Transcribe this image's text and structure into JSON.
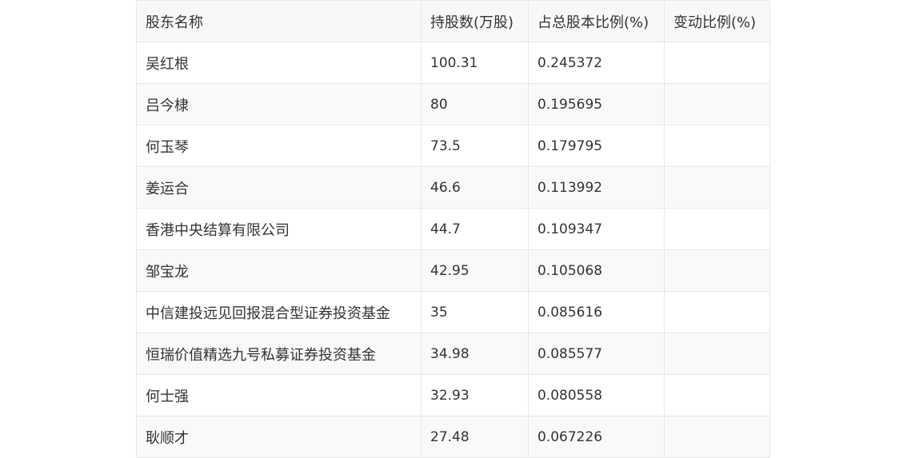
{
  "table": {
    "headers": [
      "股东名称",
      "持股数(万股)",
      "占总股本比例(%)",
      "变动比例(%)"
    ],
    "rows": [
      {
        "name": "吴红根",
        "shares": "100.31",
        "ratio": "0.245372",
        "change": ""
      },
      {
        "name": "吕今棣",
        "shares": "80",
        "ratio": "0.195695",
        "change": ""
      },
      {
        "name": "何玉琴",
        "shares": "73.5",
        "ratio": "0.179795",
        "change": ""
      },
      {
        "name": "姜运合",
        "shares": "46.6",
        "ratio": "0.113992",
        "change": ""
      },
      {
        "name": "香港中央结算有限公司",
        "shares": "44.7",
        "ratio": "0.109347",
        "change": ""
      },
      {
        "name": "邹宝龙",
        "shares": "42.95",
        "ratio": "0.105068",
        "change": ""
      },
      {
        "name": "中信建投远见回报混合型证券投资基金",
        "shares": "35",
        "ratio": "0.085616",
        "change": ""
      },
      {
        "name": "恒瑞价值精选九号私募证券投资基金",
        "shares": "34.98",
        "ratio": "0.085577",
        "change": ""
      },
      {
        "name": "何士强",
        "shares": "32.93",
        "ratio": "0.080558",
        "change": ""
      },
      {
        "name": "耿顺才",
        "shares": "27.48",
        "ratio": "0.067226",
        "change": ""
      }
    ]
  }
}
